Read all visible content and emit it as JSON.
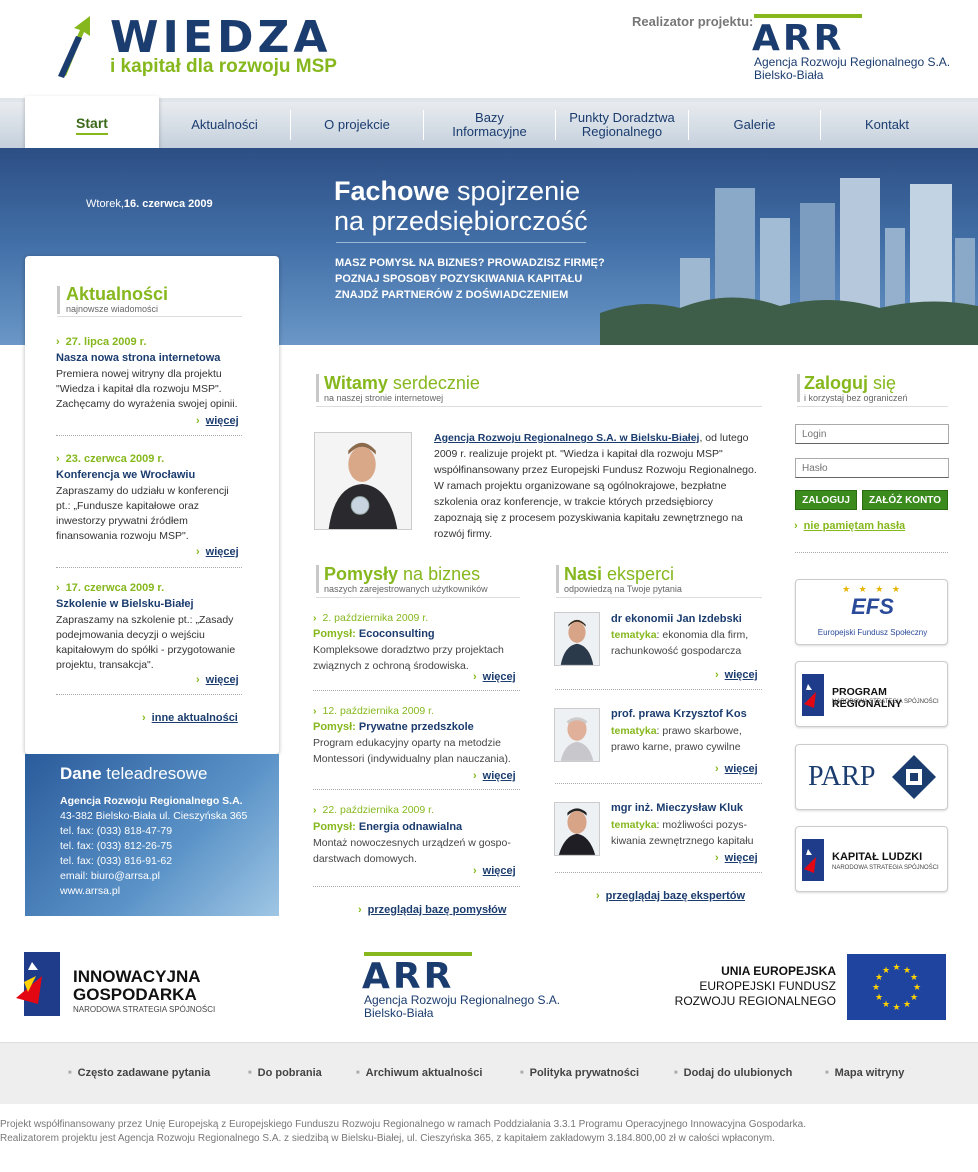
{
  "header": {
    "logo_title": "WIEDZA",
    "logo_subtitle": "i kapitał dla rozwoju MSP",
    "realizator_label": "Realizator projektu:",
    "arr_letters": "ARR",
    "arr_name_line1": "Agencja Rozwoju Regionalnego S.A.",
    "arr_name_line2": "Bielsko-Biała"
  },
  "nav": {
    "items": [
      {
        "label": "Start"
      },
      {
        "label": "Aktualności"
      },
      {
        "label": "O projekcie"
      },
      {
        "label": "Bazy\nInformacyjne"
      },
      {
        "label": "Punkty Doradztwa\nRegionalnego"
      },
      {
        "label": "Galerie"
      },
      {
        "label": "Kontakt"
      }
    ]
  },
  "hero": {
    "date_prefix": "Wtorek,",
    "date_bold": "16. czerwca 2009",
    "title_bold": "Fachowe",
    "title_rest": " spojrzenie",
    "title_line2": "na przedsiębiorczość",
    "text_line1": "MASZ POMYSŁ NA BIZNES? PROWADZISZ FIRMĘ?",
    "text_line2": "POZNAJ SPOSOBY POZYSKIWANIA KAPITAŁU",
    "text_line3": "ZNAJDŹ PARTNERÓW Z DOŚWIADCZENIEM"
  },
  "news": {
    "title": "Aktualności",
    "subtitle": "najnowsze wiadomości",
    "items": [
      {
        "date": "27. lipca 2009 r.",
        "head": "Nasza nowa strona internetowa",
        "text": "Premiera nowej witryny dla projektu \"Wiedza i kapitał dla rozwoju MSP\". Zachęcamy do wyrażenia swojej opinii.",
        "more": "więcej"
      },
      {
        "date": "23. czerwca 2009 r.",
        "head": "Konferencja we Wrocławiu",
        "text": "Zapraszamy do udziału w konferencji pt.: „Fundusze kapitałowe oraz inwestorzy prywatni źródłem finansowania rozwoju MSP\".",
        "more": "więcej"
      },
      {
        "date": "17. czerwca 2009 r.",
        "head": "Szkolenie w Bielsku-Białej",
        "text": "Zapraszamy na szkolenie pt.: „Zasady podejmowania decyzji o wejściu kapitałowym do spółki - przygotowanie projektu, transakcja\".",
        "more": "więcej"
      }
    ],
    "other_link": "inne aktualności"
  },
  "contact": {
    "title_bold": "Dane",
    "title_rest": " teleadresowe",
    "org": "Agencja Rozwoju Regionalnego S.A.",
    "address": "43-382 Bielsko-Biała ul. Cieszyńska 365",
    "tel1": "tel. fax: (033) 818-47-79",
    "tel2": "tel. fax: (033) 812-26-75",
    "tel3": "tel. fax: (033) 816-91-62",
    "email": "email: biuro@arrsa.pl",
    "www": "www.arrsa.pl"
  },
  "welcome": {
    "title_bold": "Witamy",
    "title_rest": " serdecznie",
    "subtitle": "na naszej stronie internetowej",
    "link": "Agencja Rozwoju Regionalnego S.A. w Bielsku-Białej",
    "text": ", od lutego 2009 r. realizuje projekt pt. \"Wiedza i kapitał dla rozwoju MSP\" współfinansowany przez Europejski Fundusz Rozwoju Regionalnego. W ramach projektu organizowane są ogólnokrajowe, bezpłatne szkolenia oraz konferencje, w trakcie których przedsiębiorcy zapoznają się z procesem pozyskiwania kapitału zewnętrznego na rozwój firmy."
  },
  "ideas": {
    "title_bold": "Pomysły",
    "title_rest": " na biznes",
    "subtitle": "naszych zarejestrowanych użytkowników",
    "label": "Pomysł:",
    "items": [
      {
        "date": "2. października 2009 r.",
        "name": "Ecoconsulting",
        "text": "Kompleksowe doradztwo przy projektach związnych z ochroną środowiska.",
        "more": "więcej"
      },
      {
        "date": "12. października 2009 r.",
        "name": "Prywatne przedszkole",
        "text": "Program edukacyjny oparty na metodzie Montessori (indywidualny plan nauczania).",
        "more": "więcej"
      },
      {
        "date": "22. października 2009 r.",
        "name": "Energia odnawialna",
        "text": "Montaż nowoczesnych urządzeń w gospo-darstwach domowych.",
        "more": "więcej"
      }
    ],
    "browse": "przeglądaj bazę pomysłów"
  },
  "experts": {
    "title_bold": "Nasi",
    "title_rest": " eksperci",
    "subtitle": "odpowiedzą na Twoje pytania",
    "label": "tematyka",
    "items": [
      {
        "name": "dr ekonomii Jan Izdebski",
        "topic": ": ekonomia dla firm, rachunkowość gospodarcza",
        "more": "więcej"
      },
      {
        "name": "prof. prawa Krzysztof Kos",
        "topic": ": prawo skarbowe, prawo karne, prawo cywilne",
        "more": "więcej"
      },
      {
        "name": "mgr inż. Mieczysław Kluk",
        "topic": ": możliwości pozys-kiwania zewnętrznego kapitału",
        "more": "więcej"
      }
    ],
    "browse": "przeglądaj bazę ekspertów"
  },
  "login": {
    "title_bold": "Zaloguj",
    "title_rest": " się",
    "subtitle": "i korzystaj bez ograniczeń",
    "login_placeholder": "Login",
    "password_placeholder": "Hasło",
    "login_button": "ZALOGUJ",
    "register_button": "ZAŁÓŻ KONTO",
    "forgot": "nie pamiętam hasła"
  },
  "partners": {
    "efs_logo": "EFS",
    "efs_name": "Europejski Fundusz Społeczny",
    "pr_name": "PROGRAM REGIONALNY",
    "pr_sub": "NARODOWA STRATEGIA SPÓJNOŚCI",
    "parp": "PARP",
    "kl_name": "KAPITAŁ LUDZKI",
    "kl_sub": "NARODOWA STRATEGIA SPÓJNOŚCI"
  },
  "footer_logos": {
    "ig_line1": "INNOWACYJNA",
    "ig_line2": "GOSPODARKA",
    "ig_sub": "NARODOWA STRATEGIA SPÓJNOŚCI",
    "arr_letters": "ARR",
    "arr_line1": "Agencja Rozwoju Regionalnego S.A.",
    "arr_line2": "Bielsko-Biała",
    "ue_line1": "UNIA EUROPEJSKA",
    "ue_line2": "EUROPEJSKI FUNDUSZ",
    "ue_line3": "ROZWOJU REGIONALNEGO"
  },
  "footer_nav": [
    {
      "label": "Często zadawane pytania"
    },
    {
      "label": "Do pobrania"
    },
    {
      "label": "Archiwum aktualności"
    },
    {
      "label": "Polityka prywatności"
    },
    {
      "label": "Dodaj do ulubionych"
    },
    {
      "label": "Mapa witryny"
    }
  ],
  "footer_text": {
    "line1": "Projekt współfinansowany przez Unię Europejską z Europejskiego Funduszu Rozwoju Regionalnego w ramach Poddziałania 3.3.1 Programu Operacyjnego Innowacyjna Gospodarka.",
    "line2": "Realizatorem projektu jest Agencja Rozwoju Regionalnego S.A. z siedzibą w Bielsku-Białej, ul. Cieszyńska 365, z kapitałem zakładowym 3.184.800,00 zł w całości wpłaconym."
  },
  "colors": {
    "brand_blue": "#1b3c6e",
    "brand_green": "#86b81e",
    "eu_blue": "#1f44a0",
    "eu_yellow": "#ffd200"
  }
}
